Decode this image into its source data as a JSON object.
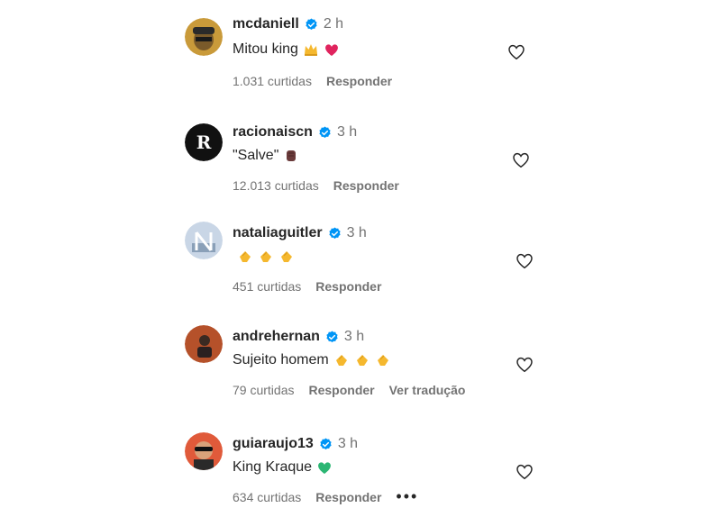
{
  "comments": [
    {
      "username": "mcdaniell",
      "time": "2 h",
      "text": "Mitou king",
      "emojis": [
        "crown",
        "red-heart"
      ],
      "likes": "1.031 curtidas",
      "reply": "Responder"
    },
    {
      "username": "racionaiscn",
      "time": "3 h",
      "text": "\"Salve\"",
      "emojis": [
        "raised-fist"
      ],
      "likes": "12.013 curtidas",
      "reply": "Responder"
    },
    {
      "username": "nataliaguitler",
      "time": "3 h",
      "text": "",
      "emojis": [
        "clapping-hands",
        "clapping-hands",
        "clapping-hands"
      ],
      "likes": "451 curtidas",
      "reply": "Responder"
    },
    {
      "username": "andrehernan",
      "time": "3 h",
      "text": "Sujeito homem",
      "emojis": [
        "clapping-hands",
        "clapping-hands",
        "clapping-hands"
      ],
      "likes": "79 curtidas",
      "reply": "Responder",
      "translate": "Ver tradução"
    },
    {
      "username": "guiaraujo13",
      "time": "3 h",
      "text": "King Kraque",
      "emojis": [
        "green-heart"
      ],
      "likes": "634 curtidas",
      "reply": "Responder",
      "more": "•••"
    }
  ],
  "colors": {
    "verified": "#0095f6",
    "muted": "#737373",
    "text": "#262626",
    "red_heart": "#e0245e",
    "green_heart": "#2bb673",
    "clap": "#f5b82e"
  }
}
